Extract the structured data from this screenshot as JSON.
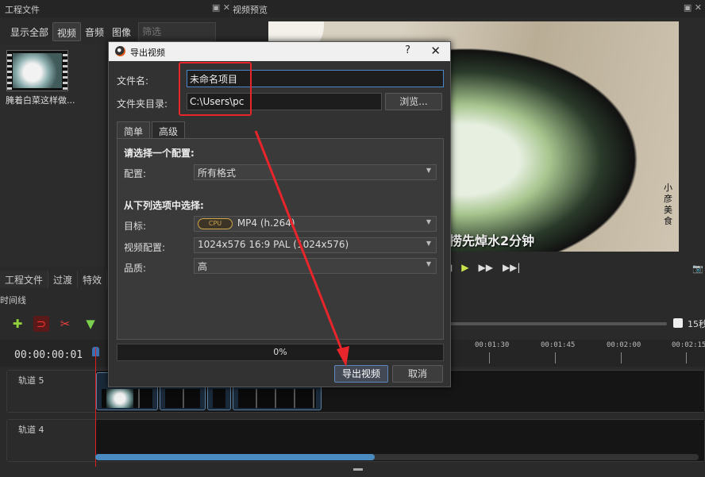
{
  "project_panel": {
    "title": "工程文件",
    "title_controls": "▣ ✕",
    "filters": [
      "显示全部",
      "视频",
      "音频",
      "图像"
    ],
    "filter_placeholder": "筛选",
    "files": [
      {
        "name": "腌着白菜这样做..."
      }
    ]
  },
  "preview_panel": {
    "title": "视频预览",
    "title_controls": "▣ ✕",
    "subtitle_fragment": "捞先焯水2分钟",
    "watermark": "小彦美食",
    "transport": {
      "prev": "◀",
      "play": "▶",
      "next": "▶▶",
      "end": "▶▶|"
    },
    "camera_icon": "camera-icon"
  },
  "bottom_tabs": [
    "工程文件",
    "过渡",
    "特效"
  ],
  "timeline": {
    "label": "时间线",
    "timecode": "00:00:00:01",
    "zoom_label": "15秒",
    "ticks": [
      "00:01:30",
      "00:01:45",
      "00:02:00",
      "00:02:15"
    ],
    "tracks": [
      {
        "name": "轨道 5"
      },
      {
        "name": "轨道 4"
      }
    ]
  },
  "dialog": {
    "title": "导出视频",
    "help": "?",
    "close": "✕",
    "filename_label": "文件名:",
    "filename_value": "未命名项目",
    "folder_label": "文件夹目录:",
    "folder_value": "C:\\Users\\pc",
    "browse": "浏览...",
    "tabs": [
      "简单",
      "高级"
    ],
    "section1_title": "请选择一个配置:",
    "config_label": "配置:",
    "config_value": "所有格式",
    "section2_title": "从下列选项中选择:",
    "target_label": "目标:",
    "target_badge": "CPU",
    "target_value": "MP4 (h.264)",
    "video_profile_label": "视频配置:",
    "video_profile_value": "1024x576 16:9 PAL (1024x576)",
    "quality_label": "品质:",
    "quality_value": "高",
    "progress_text": "0%",
    "progress": 0,
    "export_button": "导出视频",
    "cancel_button": "取消"
  },
  "colors": {
    "annotation_red": "#e8252a",
    "accent_blue": "#4a86c8",
    "play_green": "#cbe34a"
  }
}
